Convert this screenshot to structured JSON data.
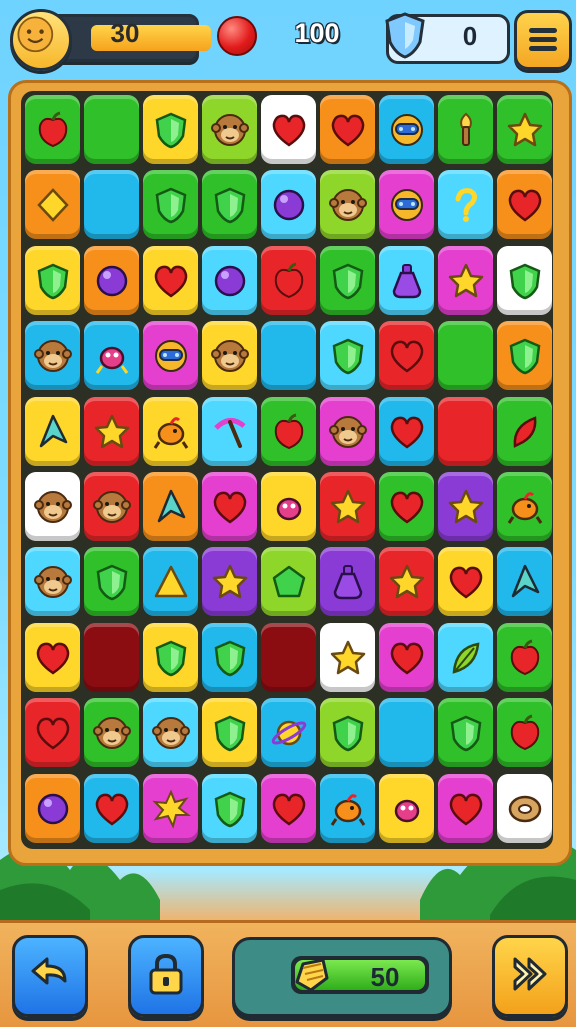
{
  "hud": {
    "level_label": "30",
    "score_label": "100",
    "shield_count": "0"
  },
  "moves": {
    "label": "50",
    "progress": 1.0
  },
  "colors": {
    "red": "#e8262a",
    "green": "#2fc02a",
    "lime": "#8fd62a",
    "orange": "#f7901a",
    "yellow": "#ffd62a",
    "blue": "#21b8ec",
    "cyan": "#4fd8ff",
    "magenta": "#e53fd0",
    "purple": "#8a3bd6",
    "white": "#ffffff",
    "maroon": "#8b0d12"
  },
  "board": {
    "rows": [
      [
        [
          "green",
          "apple"
        ],
        [
          "green",
          ""
        ],
        [
          "yellow",
          "shield"
        ],
        [
          "lime",
          "monkey"
        ],
        [
          "white",
          "heart"
        ],
        [
          "orange",
          "heart"
        ],
        [
          "blue",
          "robot"
        ],
        [
          "green",
          "torch"
        ],
        [
          "green",
          "star"
        ]
      ],
      [
        [
          "orange",
          "diamond"
        ],
        [
          "blue",
          ""
        ],
        [
          "green",
          "shield"
        ],
        [
          "green",
          "shield"
        ],
        [
          "cyan",
          "circle"
        ],
        [
          "lime",
          "monkey"
        ],
        [
          "magenta",
          "robot"
        ],
        [
          "cyan",
          "hook"
        ],
        [
          "orange",
          "heart"
        ]
      ],
      [
        [
          "yellow",
          "shield"
        ],
        [
          "orange",
          "circle"
        ],
        [
          "yellow",
          "heart"
        ],
        [
          "cyan",
          "circle"
        ],
        [
          "red",
          "apple"
        ],
        [
          "green",
          "shield"
        ],
        [
          "cyan",
          "potion"
        ],
        [
          "magenta",
          "star"
        ],
        [
          "white",
          "shield"
        ]
      ],
      [
        [
          "blue",
          "monkey"
        ],
        [
          "blue",
          "bug"
        ],
        [
          "magenta",
          "robot"
        ],
        [
          "yellow",
          "monkey"
        ],
        [
          "blue",
          ""
        ],
        [
          "cyan",
          "shield"
        ],
        [
          "red",
          "heart"
        ],
        [
          "green",
          ""
        ],
        [
          "orange",
          "shield"
        ]
      ],
      [
        [
          "yellow",
          "arrow"
        ],
        [
          "red",
          "star"
        ],
        [
          "yellow",
          "bird"
        ],
        [
          "cyan",
          "pick"
        ],
        [
          "green",
          "apple"
        ],
        [
          "magenta",
          "monkey"
        ],
        [
          "blue",
          "heart"
        ],
        [
          "red",
          ""
        ],
        [
          "green",
          "feather"
        ]
      ],
      [
        [
          "white",
          "monkey"
        ],
        [
          "red",
          "monkey"
        ],
        [
          "orange",
          "arrow"
        ],
        [
          "magenta",
          "heart"
        ],
        [
          "yellow",
          "bug"
        ],
        [
          "red",
          "star"
        ],
        [
          "green",
          "heart"
        ],
        [
          "purple",
          "star"
        ],
        [
          "green",
          "bird"
        ]
      ],
      [
        [
          "cyan",
          "monkey"
        ],
        [
          "green",
          "shield"
        ],
        [
          "blue",
          "triangle"
        ],
        [
          "purple",
          "star"
        ],
        [
          "lime",
          "pentagon"
        ],
        [
          "purple",
          "potion"
        ],
        [
          "red",
          "star"
        ],
        [
          "yellow",
          "heart"
        ],
        [
          "blue",
          "arrow"
        ]
      ],
      [
        [
          "yellow",
          "heart"
        ],
        [
          "maroon",
          ""
        ],
        [
          "yellow",
          "shield"
        ],
        [
          "blue",
          "shield"
        ],
        [
          "maroon",
          ""
        ],
        [
          "white",
          "star"
        ],
        [
          "magenta",
          "heart"
        ],
        [
          "cyan",
          "leaf"
        ],
        [
          "green",
          "apple"
        ]
      ],
      [
        [
          "red",
          "heart"
        ],
        [
          "green",
          "monkey"
        ],
        [
          "cyan",
          "monkey"
        ],
        [
          "yellow",
          "shield"
        ],
        [
          "blue",
          "planet"
        ],
        [
          "lime",
          "shield"
        ],
        [
          "blue",
          ""
        ],
        [
          "green",
          "shield"
        ],
        [
          "green",
          "apple"
        ]
      ],
      [
        [
          "orange",
          "circle"
        ],
        [
          "blue",
          "heart"
        ],
        [
          "magenta",
          "burst"
        ],
        [
          "cyan",
          "shield"
        ],
        [
          "magenta",
          "heart"
        ],
        [
          "blue",
          "bird"
        ],
        [
          "yellow",
          "bug"
        ],
        [
          "magenta",
          "heart"
        ],
        [
          "white",
          "donut"
        ]
      ]
    ]
  }
}
